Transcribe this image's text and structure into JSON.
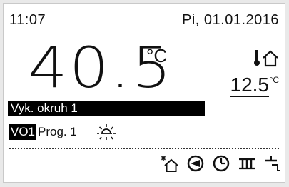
{
  "status_bar": {
    "time": "11:07",
    "date": "Pi, 01.01.2016"
  },
  "main": {
    "flow_temp": "40.5",
    "flow_unit": "°C",
    "outdoor_temp": "12.5",
    "outdoor_unit": "°C"
  },
  "circuit": {
    "label": "Vyk. okruh 1",
    "badge": "VO1",
    "program": "Prog. 1"
  },
  "icons": {
    "outdoor": "thermometer-house-icon",
    "mode": "sun-icon",
    "bottom": [
      "vacation-house-icon",
      "circulation-pump-icon",
      "clock-icon",
      "radiator-icon",
      "shower-icon"
    ]
  }
}
